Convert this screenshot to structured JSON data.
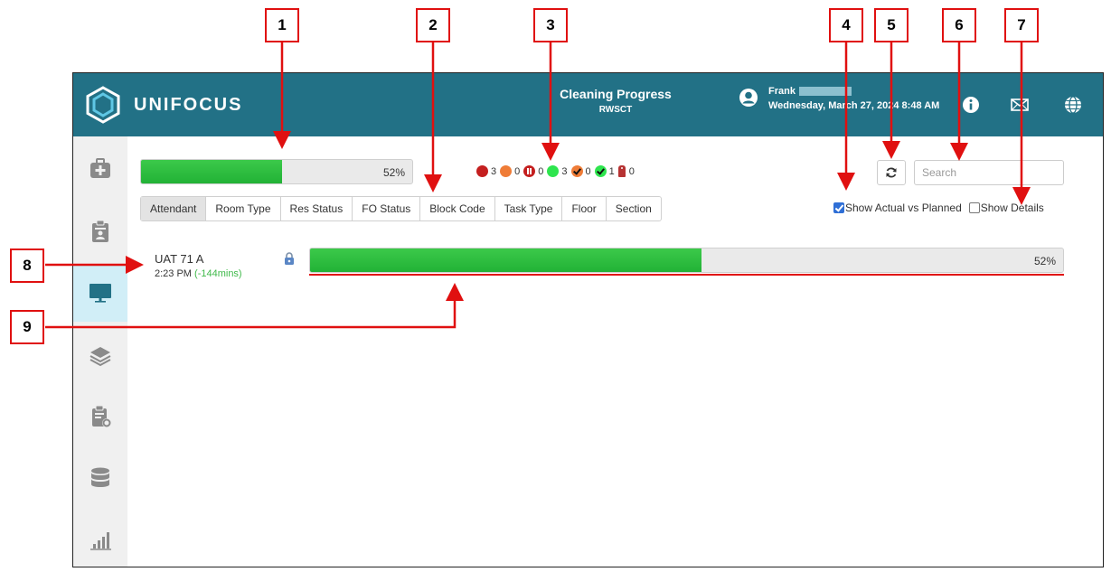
{
  "app": {
    "brand": "UNIFOCUS",
    "title": "Cleaning Progress",
    "subtitle": "RWSCT",
    "user_name": "Frank",
    "datetime": "Wednesday, March 27, 2024 8:48 AM"
  },
  "sidebar": {
    "items": [
      {
        "icon": "first-aid-kit-icon"
      },
      {
        "icon": "clipboard-user-icon"
      },
      {
        "icon": "monitor-icon",
        "active": true
      },
      {
        "icon": "layers-icon"
      },
      {
        "icon": "clipboard-settings-icon"
      },
      {
        "icon": "database-icon"
      },
      {
        "icon": "bar-chart-icon"
      }
    ]
  },
  "overall": {
    "percent": 52,
    "label": "52%"
  },
  "status_counts": [
    {
      "icon": "red-dot-icon",
      "count": "3"
    },
    {
      "icon": "orange-dot-icon",
      "count": "0"
    },
    {
      "icon": "paused-icon",
      "count": "0"
    },
    {
      "icon": "green-dot-icon",
      "count": "3"
    },
    {
      "icon": "orange-check-icon",
      "count": "0"
    },
    {
      "icon": "green-check-icon",
      "count": "1"
    },
    {
      "icon": "tag-icon",
      "count": "0"
    }
  ],
  "tabs": [
    "Attendant",
    "Room Type",
    "Res Status",
    "FO Status",
    "Block Code",
    "Task Type",
    "Floor",
    "Section"
  ],
  "active_tab": "Attendant",
  "search": {
    "placeholder": "Search",
    "value": ""
  },
  "options": {
    "show_actual_vs_planned": "Show Actual vs Planned",
    "show_actual_checked": true,
    "show_details": "Show Details",
    "show_details_checked": false
  },
  "attendants": [
    {
      "name": "UAT 71 A",
      "time": "2:23 PM",
      "delta": "(-144mins)",
      "percent": 52,
      "label": "52%"
    }
  ],
  "callouts": [
    "1",
    "2",
    "3",
    "4",
    "5",
    "6",
    "7",
    "8",
    "9"
  ],
  "colors": {
    "header": "#227186",
    "progress": "#22b236",
    "annotation": "#e01010"
  }
}
